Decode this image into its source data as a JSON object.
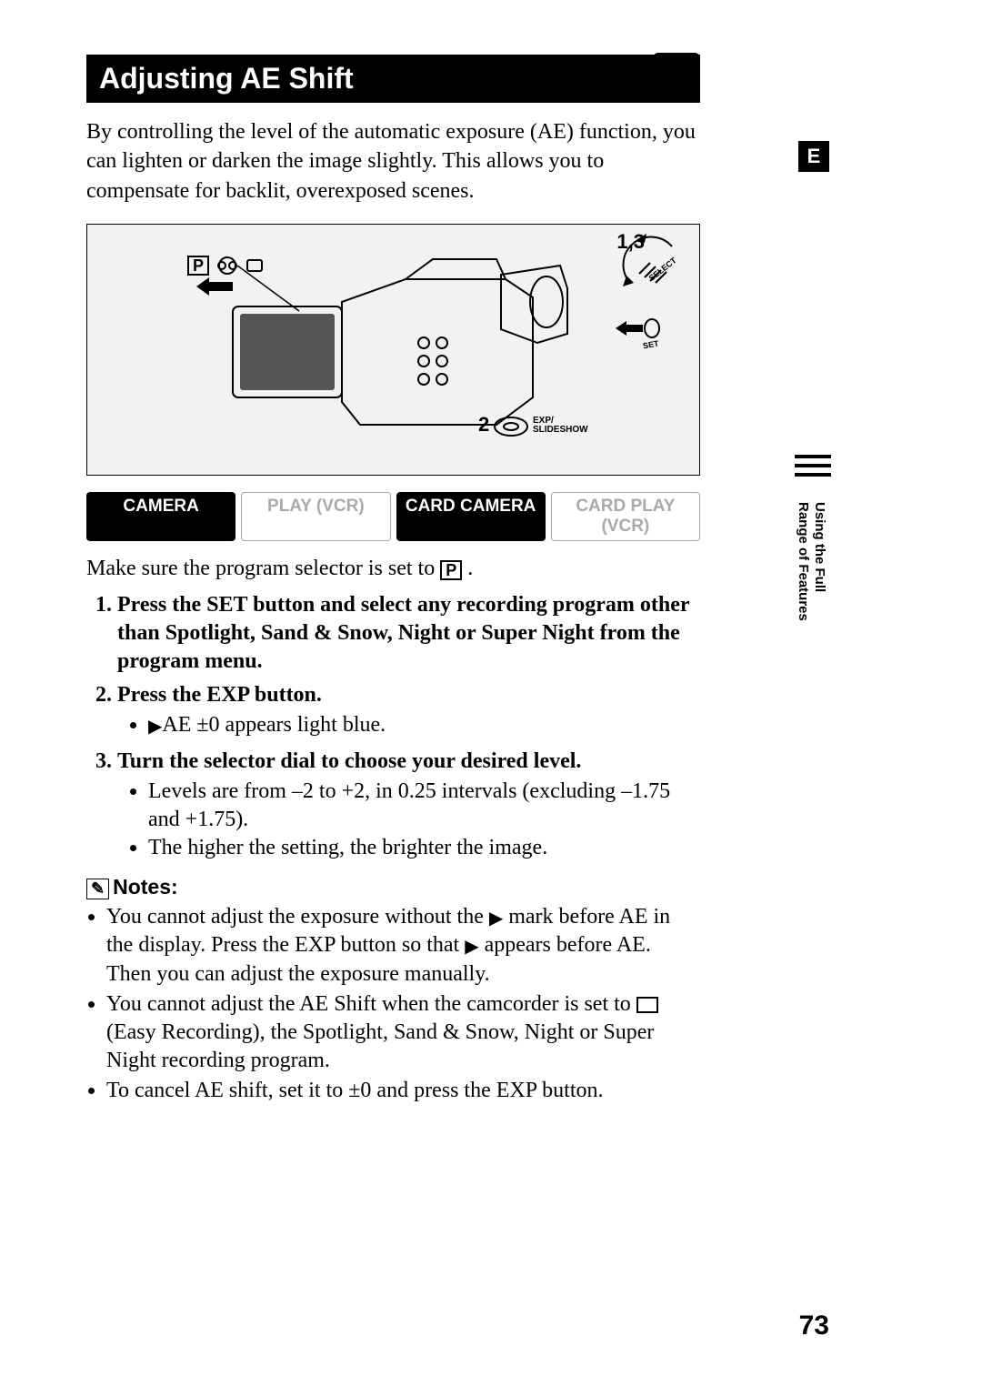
{
  "title": "Adjusting AE Shift",
  "intro": "By controlling the level of the automatic exposure (AE) function, you can lighten or darken the image slightly. This allows you to compensate for backlit, overexposed scenes.",
  "diagram": {
    "callout_1_3": "1,3",
    "callout_2": "2",
    "dial_select": "SELECT",
    "dial_set": "SET",
    "exp_label_1": "EXP/",
    "exp_label_2": "SLIDESHOW",
    "prog_icon": "P"
  },
  "modes": [
    {
      "label": "CAMERA",
      "style": "active"
    },
    {
      "label": "PLAY (VCR)",
      "style": "dim"
    },
    {
      "label": "CARD CAMERA",
      "style": "avail"
    },
    {
      "label": "CARD PLAY (VCR)",
      "style": "dim"
    }
  ],
  "pre_steps_text_a": "Make sure the program selector is set to ",
  "pre_steps_text_b": " .",
  "steps": {
    "s1": "Press the SET button and select any recording program other than Spotlight, Sand & Snow, Night or Super Night from the program menu.",
    "s2": "Press the EXP button.",
    "s2_bullets": {
      "b1_a": "AE ±0 appears light blue."
    },
    "s3": "Turn the selector dial to choose your desired level.",
    "s3_bullets": {
      "b1": "Levels are from –2 to +2, in 0.25 intervals (excluding –1.75 and +1.75).",
      "b2": "The higher the setting, the brighter the image."
    }
  },
  "notes_heading": "Notes:",
  "notes": {
    "n1_a": "You cannot adjust the exposure without the ",
    "n1_b": " mark before AE in the display. Press the EXP button so that ",
    "n1_c": " appears before AE. Then you can adjust the exposure manually.",
    "n2_a": "You cannot adjust the AE Shift when the camcorder is set to ",
    "n2_b": " (Easy Recording), the Spotlight, Sand & Snow, Night or Super Night recording program.",
    "n3": "To cancel AE shift, set it to ±0 and press the EXP button."
  },
  "side": {
    "lang": "E",
    "section_line1": "Using the Full",
    "section_line2": "Range of Features"
  },
  "page_number": "73"
}
